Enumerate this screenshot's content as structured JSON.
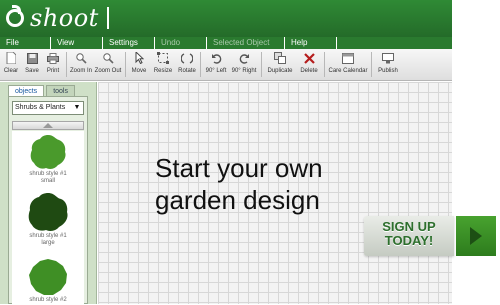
{
  "header": {
    "logo_text": "shoot"
  },
  "menu": [
    {
      "label": "File",
      "disabled": false
    },
    {
      "label": "View",
      "disabled": false
    },
    {
      "label": "Settings",
      "disabled": false
    },
    {
      "label": "Undo",
      "disabled": true
    },
    {
      "label": "Selected Object",
      "disabled": true
    },
    {
      "label": "Help",
      "disabled": false
    }
  ],
  "toolbar": {
    "clear": "Clear",
    "save": "Save",
    "print": "Print",
    "zoom_in": "Zoom In",
    "zoom_out": "Zoom Out",
    "move": "Move",
    "resize": "Resize",
    "rotate": "Rotate",
    "rot_left": "90° Left",
    "rot_right": "90° Right",
    "duplicate": "Duplicate",
    "delete": "Delete",
    "care_calendar": "Care Calendar",
    "publish": "Publish"
  },
  "panel": {
    "tabs": [
      "objects",
      "tools"
    ],
    "category": "Shrubs & Plants",
    "items": [
      {
        "name": "shrub style #1",
        "size": "small",
        "color": "#4a9a2c"
      },
      {
        "name": "shrub style #1",
        "size": "large",
        "color": "#1f4a12"
      },
      {
        "name": "shrub style #2",
        "size": "",
        "color": "#3f8f25"
      }
    ]
  },
  "canvas": {
    "headline_line1": "Start your own",
    "headline_line2": "garden design"
  },
  "cta": {
    "line1": "SIGN UP",
    "line2": "TODAY!"
  },
  "colors": {
    "brand_green": "#2e7d32",
    "cta_green": "#3c9328"
  }
}
